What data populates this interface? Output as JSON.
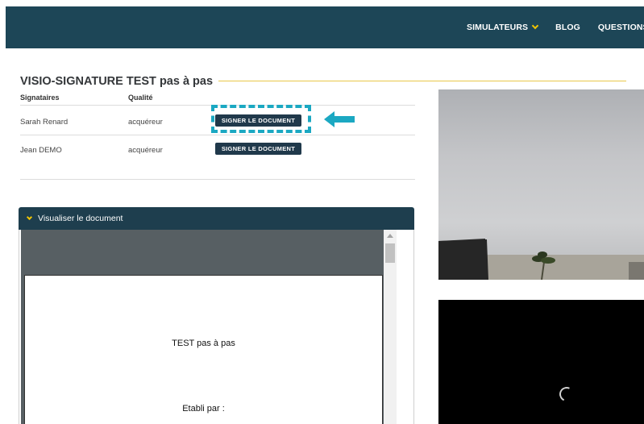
{
  "nav": {
    "items": [
      {
        "label": "SIMULATEURS",
        "has_dropdown": true
      },
      {
        "label": "BLOG",
        "has_dropdown": false
      },
      {
        "label": "QUESTIONS FRÉ",
        "has_dropdown": false
      }
    ]
  },
  "page": {
    "title": "VISIO-SIGNATURE TEST pas à pas"
  },
  "signers": {
    "headers": {
      "name": "Signataires",
      "role": "Qualité"
    },
    "rows": [
      {
        "name": "Sarah Renard",
        "role": "acquéreur",
        "button": "SIGNER LE DOCUMENT"
      },
      {
        "name": "Jean DEMO",
        "role": "acquéreur",
        "button": "SIGNER LE DOCUMENT"
      }
    ]
  },
  "viewer": {
    "label": "Visualiser le document",
    "doc_lines": [
      "TEST pas à pas",
      "Etabli par :"
    ]
  },
  "colors": {
    "header_bg": "#1d4657",
    "accent_yellow": "#f2c500",
    "button_bg": "#20394b",
    "highlight_cyan": "#1ba8c2"
  },
  "icons": [
    "chevron-down-icon",
    "arrow-left-icon",
    "loading-spinner-icon"
  ]
}
